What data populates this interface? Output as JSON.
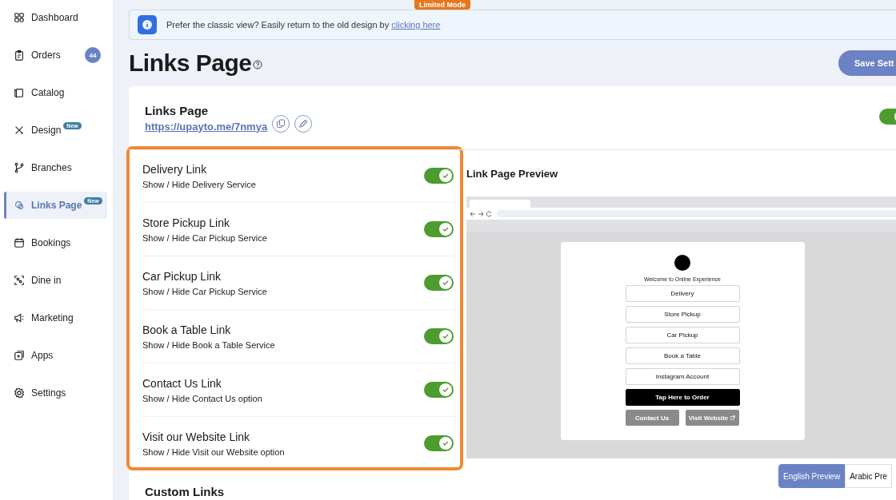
{
  "sidebar": {
    "items": [
      {
        "label": "Dashboard",
        "selected": false
      },
      {
        "label": "Orders",
        "badge": "44",
        "selected": false
      },
      {
        "label": "Catalog",
        "selected": false
      },
      {
        "label": "Design",
        "tag": "New",
        "selected": false
      },
      {
        "label": "Branches",
        "selected": false
      },
      {
        "label": "Links Page",
        "tag": "New",
        "selected": true
      },
      {
        "label": "Bookings",
        "selected": false
      },
      {
        "label": "Dine in",
        "selected": false
      },
      {
        "label": "Marketing",
        "selected": false
      },
      {
        "label": "Apps",
        "selected": false
      },
      {
        "label": "Settings",
        "selected": false
      }
    ]
  },
  "mode_badge": "Limited Mode",
  "banner": {
    "text": "Prefer the classic view? Easily return to the old design by",
    "link": "clicking here"
  },
  "page_title": "Links Page",
  "save_button": "Save Sett",
  "card": {
    "title": "Links Page",
    "url": "https://upayto.me/7nmya",
    "enabled": true
  },
  "links": [
    {
      "title": "Delivery Link",
      "subtitle": "Show / Hide Delivery Service",
      "on": true
    },
    {
      "title": "Store Pickup Link",
      "subtitle": "Show / Hide Car Pickup Service",
      "on": true
    },
    {
      "title": "Car Pickup Link",
      "subtitle": "Show / Hide Car Pickup Service",
      "on": true
    },
    {
      "title": "Book a Table Link",
      "subtitle": "Show / Hide Book a Table Service",
      "on": true
    },
    {
      "title": "Contact Us Link",
      "subtitle": "Show / Hide Contact Us option",
      "on": true
    },
    {
      "title": "Visit our Website Link",
      "subtitle": "Show / Hide Visit our Website option",
      "on": true
    }
  ],
  "preview": {
    "title": "Link Page Preview",
    "welcome": "Welcome to Online Experience",
    "buttons": [
      {
        "label": "Delivery",
        "kind": "outline"
      },
      {
        "label": "Store Pickup",
        "kind": "outline"
      },
      {
        "label": "Car Pickup",
        "kind": "outline"
      },
      {
        "label": "Book a Table",
        "kind": "outline"
      },
      {
        "label": "Instagram Account",
        "kind": "outline"
      },
      {
        "label": "Tap Here to Order",
        "kind": "primary"
      }
    ],
    "footer_buttons": [
      {
        "label": "Contact Us",
        "external": false
      },
      {
        "label": "Visit Website",
        "external": true
      }
    ],
    "languages": [
      {
        "label": "English Preview",
        "selected": true
      },
      {
        "label": "Arabic Pre",
        "selected": false
      }
    ]
  },
  "custom_links_title": "Custom Links"
}
